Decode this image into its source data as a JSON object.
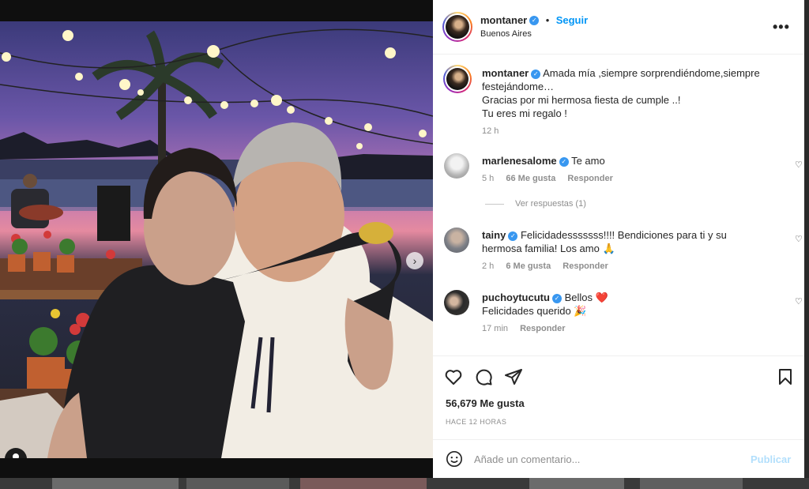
{
  "post": {
    "author": "montaner",
    "follow_label": "Seguir",
    "separator": "•",
    "location": "Buenos Aires",
    "more_label": "•••",
    "caption_author": "montaner",
    "caption_lines": [
      "Amada mía ,siempre sorprendiéndome,siempre",
      "festejándome…",
      "Gracias por mi hermosa fiesta de cumple ..!",
      "Tu eres mi regalo !"
    ],
    "caption_time": "12 h",
    "likes": "56,679 Me gusta",
    "posted_ago": "HACE 12 HORAS"
  },
  "comments": [
    {
      "user": "marlenesalome",
      "text": "Te amo",
      "time": "5 h",
      "likes": "66 Me gusta",
      "reply": "Responder"
    },
    {
      "user": "tainy",
      "text_1": "Felicidadesssssss!!!! Bendiciones para ti y su",
      "text_2": "hermosa familia! Los amo 🙏",
      "time": "2 h",
      "likes": "6 Me gusta",
      "reply": "Responder"
    },
    {
      "user": "puchoytucutu",
      "text_1": "Bellos ❤️",
      "text_2": "Felicidades querido 🎉",
      "time": "17 min",
      "reply": "Responder"
    }
  ],
  "view_replies": "Ver respuestas (1)",
  "comment_box": {
    "placeholder": "Añade un comentario...",
    "publish_label": "Publicar"
  },
  "icons": {
    "verified": "verified-badge-icon",
    "more": "more-options-icon",
    "like": "heart-icon",
    "comment": "comment-bubble-icon",
    "share": "paper-plane-icon",
    "save": "bookmark-icon",
    "emoji": "emoji-icon",
    "next": "chevron-right-icon",
    "tag": "user-tag-icon"
  },
  "colors": {
    "accent": "#0095f6",
    "verified": "#3897f0",
    "publish_disabled": "#b2dffc",
    "text": "#262626",
    "muted": "#8e8e8e"
  }
}
